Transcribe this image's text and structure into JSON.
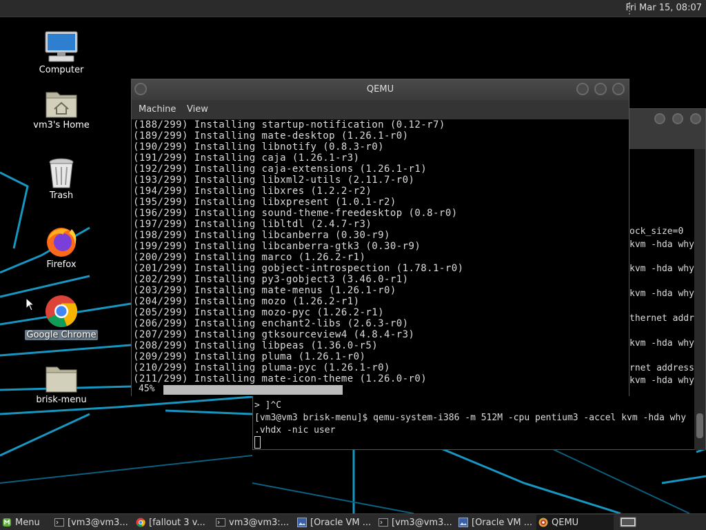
{
  "top_panel": {
    "clock": "Fri Mar 15, 08:07"
  },
  "desktop_icons": [
    {
      "label": "Computer",
      "icon": "computer-icon"
    },
    {
      "label": "vm3's Home",
      "icon": "home-folder-icon"
    },
    {
      "label": "Trash",
      "icon": "trash-icon"
    },
    {
      "label": "Firefox",
      "icon": "firefox-icon"
    },
    {
      "label": "Google Chrome",
      "icon": "chrome-icon",
      "selected": true
    },
    {
      "label": "brisk-menu",
      "icon": "folder-icon"
    }
  ],
  "terminal": {
    "visible_fragments": [
      "ock_size=0",
      "kvm -hda why",
      "kvm -hda why",
      "kvm -hda why",
      "thernet addr",
      "kvm -hda why",
      "rnet address",
      "kvm -hda why"
    ],
    "lines": [
      "> ]^C",
      "[vm3@vm3 brisk-menu]$ qemu-system-i386 -m 512M -cpu pentium3 -accel kvm -hda why",
      ".vhdx -nic user"
    ]
  },
  "qemu": {
    "title": "QEMU",
    "menu": [
      "Machine",
      "View"
    ],
    "console_lines": [
      "(188/299) Installing startup-notification (0.12-r7)",
      "(189/299) Installing mate-desktop (1.26.1-r0)",
      "(190/299) Installing libnotify (0.8.3-r0)",
      "(191/299) Installing caja (1.26.1-r3)",
      "(192/299) Installing caja-extensions (1.26.1-r1)",
      "(193/299) Installing libxml2-utils (2.11.7-r0)",
      "(194/299) Installing libxres (1.2.2-r2)",
      "(195/299) Installing libxpresent (1.0.1-r2)",
      "(196/299) Installing sound-theme-freedesktop (0.8-r0)",
      "(197/299) Installing libltdl (2.4.7-r3)",
      "(198/299) Installing libcanberra (0.30-r9)",
      "(199/299) Installing libcanberra-gtk3 (0.30-r9)",
      "(200/299) Installing marco (1.26.2-r1)",
      "(201/299) Installing gobject-introspection (1.78.1-r0)",
      "(202/299) Installing py3-gobject3 (3.46.0-r1)",
      "(203/299) Installing mate-menus (1.26.1-r0)",
      "(204/299) Installing mozo (1.26.2-r1)",
      "(205/299) Installing mozo-pyc (1.26.2-r1)",
      "(206/299) Installing enchant2-libs (2.6.3-r0)",
      "(207/299) Installing gtksourceview4 (4.8.4-r3)",
      "(208/299) Installing libpeas (1.36.0-r5)",
      "(209/299) Installing pluma (1.26.1-r0)",
      "(210/299) Installing pluma-pyc (1.26.1-r0)",
      "(211/299) Installing mate-icon-theme (1.26.0-r0)"
    ],
    "progress_text": "45%",
    "progress": 0.45
  },
  "taskbar": {
    "menu_label": "Menu",
    "tasks": [
      {
        "label": "[vm3@vm3...",
        "icon": "terminal-icon"
      },
      {
        "label": "[fallout 3 v...",
        "icon": "chrome-icon"
      },
      {
        "label": "vm3@vm3:...",
        "icon": "terminal-icon"
      },
      {
        "label": "[Oracle VM ...",
        "icon": "image-viewer-icon"
      },
      {
        "label": "[vm3@vm3...",
        "icon": "terminal-icon"
      },
      {
        "label": "[Oracle VM ...",
        "icon": "image-viewer-icon"
      },
      {
        "label": "QEMU",
        "icon": "qemu-icon",
        "active": true
      }
    ]
  },
  "colors": {
    "panel": "#2b2b2b",
    "wallpaper_lines": "#1aa7d6",
    "progress_fill": "#bbbbbb"
  }
}
